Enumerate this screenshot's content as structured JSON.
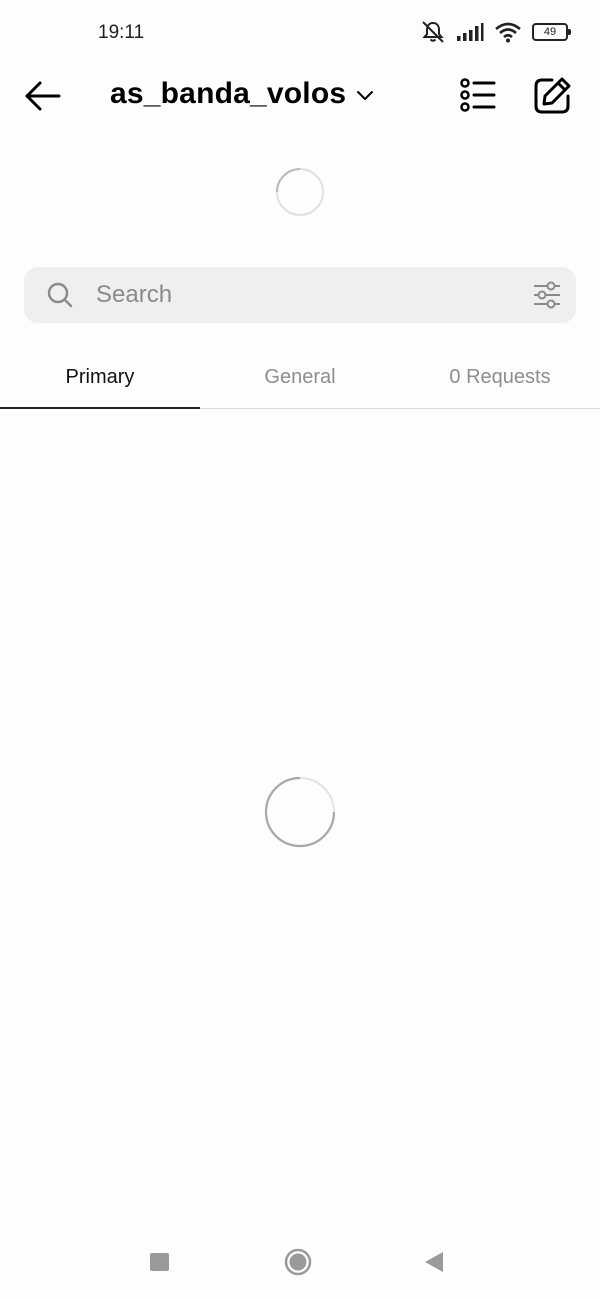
{
  "status_bar": {
    "time": "19:11",
    "battery": "49",
    "icons": [
      "mute-icon",
      "signal-icon",
      "wifi-icon",
      "battery-icon"
    ]
  },
  "header": {
    "account_name": "as_banda_volos",
    "icons": [
      "back-arrow-icon",
      "chevron-down-icon",
      "list-icon",
      "compose-icon"
    ]
  },
  "search": {
    "placeholder": "Search",
    "value": ""
  },
  "tabs": [
    {
      "label": "Primary",
      "active": true
    },
    {
      "label": "General",
      "active": false
    },
    {
      "label": "0 Requests",
      "active": false
    }
  ],
  "colors": {
    "background": "#fdfdfd",
    "search_bg": "#efefef",
    "inactive_tab": "#8e8e8e",
    "active_tab": "#111111"
  }
}
